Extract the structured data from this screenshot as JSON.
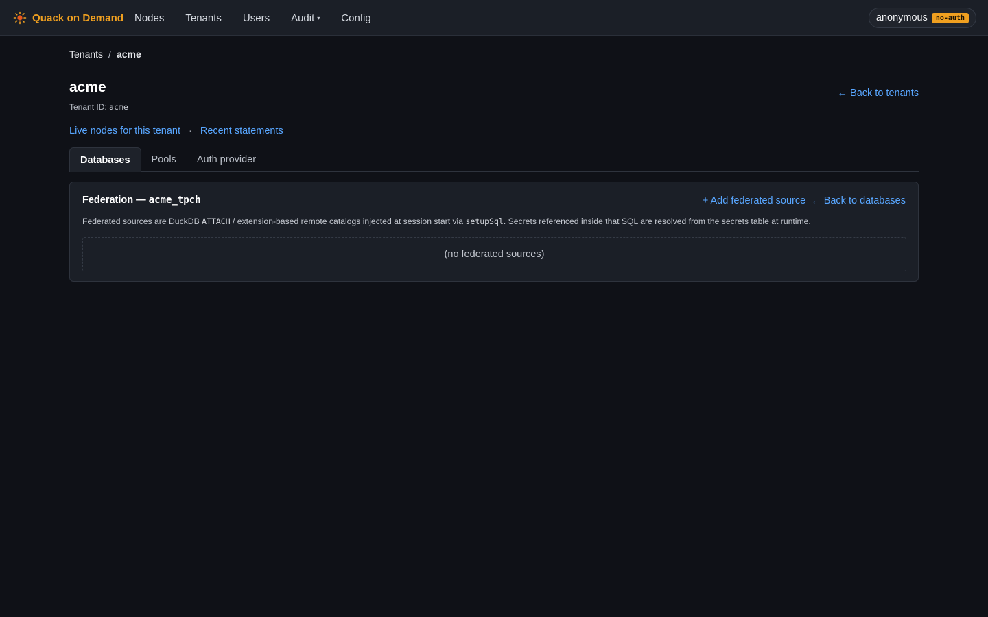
{
  "app": {
    "brand": "Quack on Demand",
    "brand_color": "#f0a020",
    "brand_icon": "sun-icon"
  },
  "nav": {
    "items": [
      {
        "label": "Nodes"
      },
      {
        "label": "Tenants"
      },
      {
        "label": "Users"
      },
      {
        "label": "Audit",
        "has_dropdown": true,
        "caret": "▾"
      },
      {
        "label": "Config"
      }
    ]
  },
  "user": {
    "name": "anonymous",
    "badge": "no-auth"
  },
  "breadcrumb": {
    "parent": "Tenants",
    "separator": "/",
    "current": "acme"
  },
  "header": {
    "title": "acme",
    "tenant_id_label": "Tenant ID:",
    "tenant_id": "acme",
    "back_link": "← Back to tenants"
  },
  "quick_links": {
    "live_nodes": "Live nodes for this tenant",
    "separator": "·",
    "recent_statements": "Recent statements"
  },
  "tabs": [
    {
      "label": "Databases",
      "active": true
    },
    {
      "label": "Pools",
      "active": false
    },
    {
      "label": "Auth provider",
      "active": false
    }
  ],
  "federation": {
    "title_prefix": "Federation —",
    "database": "acme_tpch",
    "add_source": "+ Add federated source",
    "back_databases": "← Back to databases",
    "desc_part1": "Federated sources are DuckDB",
    "desc_code1": "ATTACH",
    "desc_part2": "/ extension-based remote catalogs injected at session start via",
    "desc_code2": "setupSql",
    "desc_part3": ". Secrets referenced inside that SQL are resolved from the secrets table at runtime.",
    "empty_text": "(no federated sources)"
  },
  "colors": {
    "background": "#0f1117",
    "surface": "#1b1f27",
    "link": "#58a6ff",
    "accent": "#f0a020"
  }
}
